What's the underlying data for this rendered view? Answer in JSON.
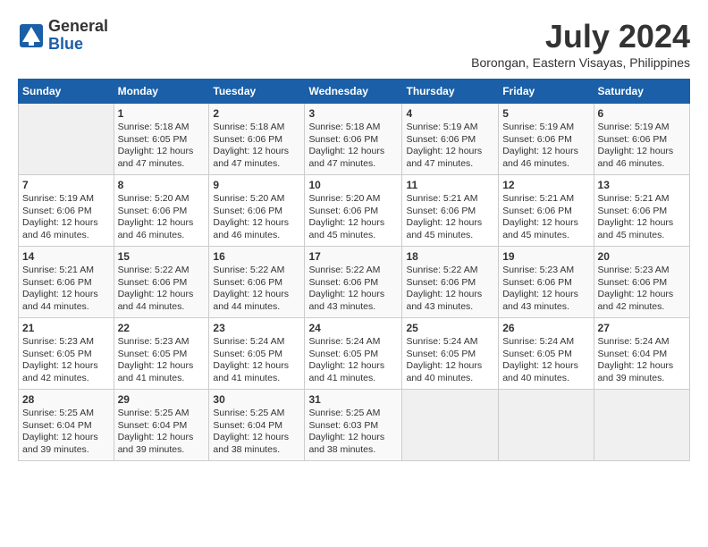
{
  "logo": {
    "general": "General",
    "blue": "Blue"
  },
  "title": "July 2024",
  "subtitle": "Borongan, Eastern Visayas, Philippines",
  "header": {
    "days": [
      "Sunday",
      "Monday",
      "Tuesday",
      "Wednesday",
      "Thursday",
      "Friday",
      "Saturday"
    ]
  },
  "weeks": [
    [
      {
        "day": "",
        "info": ""
      },
      {
        "day": "1",
        "info": "Sunrise: 5:18 AM\nSunset: 6:05 PM\nDaylight: 12 hours\nand 47 minutes."
      },
      {
        "day": "2",
        "info": "Sunrise: 5:18 AM\nSunset: 6:06 PM\nDaylight: 12 hours\nand 47 minutes."
      },
      {
        "day": "3",
        "info": "Sunrise: 5:18 AM\nSunset: 6:06 PM\nDaylight: 12 hours\nand 47 minutes."
      },
      {
        "day": "4",
        "info": "Sunrise: 5:19 AM\nSunset: 6:06 PM\nDaylight: 12 hours\nand 47 minutes."
      },
      {
        "day": "5",
        "info": "Sunrise: 5:19 AM\nSunset: 6:06 PM\nDaylight: 12 hours\nand 46 minutes."
      },
      {
        "day": "6",
        "info": "Sunrise: 5:19 AM\nSunset: 6:06 PM\nDaylight: 12 hours\nand 46 minutes."
      }
    ],
    [
      {
        "day": "7",
        "info": "Sunrise: 5:19 AM\nSunset: 6:06 PM\nDaylight: 12 hours\nand 46 minutes."
      },
      {
        "day": "8",
        "info": "Sunrise: 5:20 AM\nSunset: 6:06 PM\nDaylight: 12 hours\nand 46 minutes."
      },
      {
        "day": "9",
        "info": "Sunrise: 5:20 AM\nSunset: 6:06 PM\nDaylight: 12 hours\nand 46 minutes."
      },
      {
        "day": "10",
        "info": "Sunrise: 5:20 AM\nSunset: 6:06 PM\nDaylight: 12 hours\nand 45 minutes."
      },
      {
        "day": "11",
        "info": "Sunrise: 5:21 AM\nSunset: 6:06 PM\nDaylight: 12 hours\nand 45 minutes."
      },
      {
        "day": "12",
        "info": "Sunrise: 5:21 AM\nSunset: 6:06 PM\nDaylight: 12 hours\nand 45 minutes."
      },
      {
        "day": "13",
        "info": "Sunrise: 5:21 AM\nSunset: 6:06 PM\nDaylight: 12 hours\nand 45 minutes."
      }
    ],
    [
      {
        "day": "14",
        "info": "Sunrise: 5:21 AM\nSunset: 6:06 PM\nDaylight: 12 hours\nand 44 minutes."
      },
      {
        "day": "15",
        "info": "Sunrise: 5:22 AM\nSunset: 6:06 PM\nDaylight: 12 hours\nand 44 minutes."
      },
      {
        "day": "16",
        "info": "Sunrise: 5:22 AM\nSunset: 6:06 PM\nDaylight: 12 hours\nand 44 minutes."
      },
      {
        "day": "17",
        "info": "Sunrise: 5:22 AM\nSunset: 6:06 PM\nDaylight: 12 hours\nand 43 minutes."
      },
      {
        "day": "18",
        "info": "Sunrise: 5:22 AM\nSunset: 6:06 PM\nDaylight: 12 hours\nand 43 minutes."
      },
      {
        "day": "19",
        "info": "Sunrise: 5:23 AM\nSunset: 6:06 PM\nDaylight: 12 hours\nand 43 minutes."
      },
      {
        "day": "20",
        "info": "Sunrise: 5:23 AM\nSunset: 6:06 PM\nDaylight: 12 hours\nand 42 minutes."
      }
    ],
    [
      {
        "day": "21",
        "info": "Sunrise: 5:23 AM\nSunset: 6:05 PM\nDaylight: 12 hours\nand 42 minutes."
      },
      {
        "day": "22",
        "info": "Sunrise: 5:23 AM\nSunset: 6:05 PM\nDaylight: 12 hours\nand 41 minutes."
      },
      {
        "day": "23",
        "info": "Sunrise: 5:24 AM\nSunset: 6:05 PM\nDaylight: 12 hours\nand 41 minutes."
      },
      {
        "day": "24",
        "info": "Sunrise: 5:24 AM\nSunset: 6:05 PM\nDaylight: 12 hours\nand 41 minutes."
      },
      {
        "day": "25",
        "info": "Sunrise: 5:24 AM\nSunset: 6:05 PM\nDaylight: 12 hours\nand 40 minutes."
      },
      {
        "day": "26",
        "info": "Sunrise: 5:24 AM\nSunset: 6:05 PM\nDaylight: 12 hours\nand 40 minutes."
      },
      {
        "day": "27",
        "info": "Sunrise: 5:24 AM\nSunset: 6:04 PM\nDaylight: 12 hours\nand 39 minutes."
      }
    ],
    [
      {
        "day": "28",
        "info": "Sunrise: 5:25 AM\nSunset: 6:04 PM\nDaylight: 12 hours\nand 39 minutes."
      },
      {
        "day": "29",
        "info": "Sunrise: 5:25 AM\nSunset: 6:04 PM\nDaylight: 12 hours\nand 39 minutes."
      },
      {
        "day": "30",
        "info": "Sunrise: 5:25 AM\nSunset: 6:04 PM\nDaylight: 12 hours\nand 38 minutes."
      },
      {
        "day": "31",
        "info": "Sunrise: 5:25 AM\nSunset: 6:03 PM\nDaylight: 12 hours\nand 38 minutes."
      },
      {
        "day": "",
        "info": ""
      },
      {
        "day": "",
        "info": ""
      },
      {
        "day": "",
        "info": ""
      }
    ]
  ]
}
